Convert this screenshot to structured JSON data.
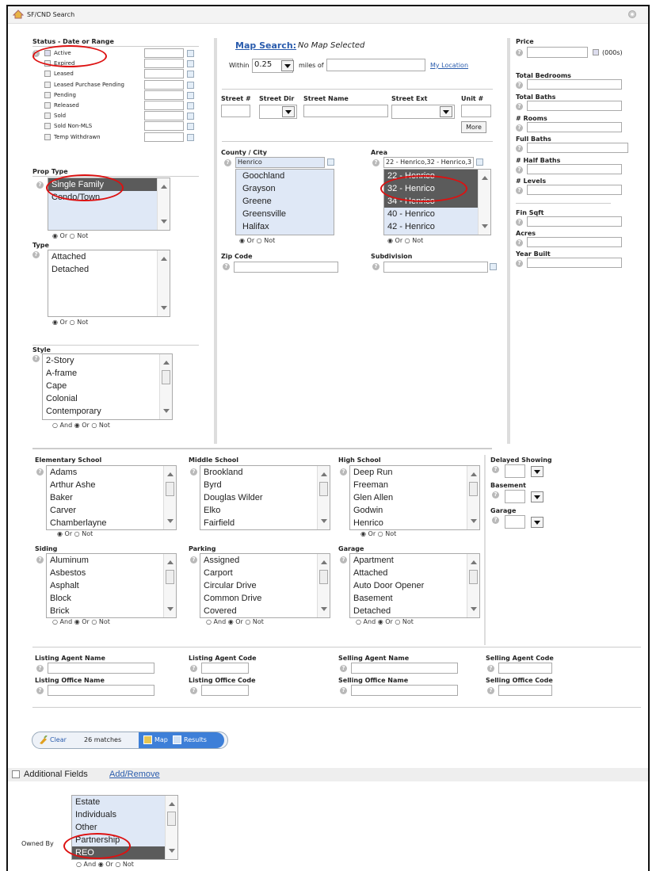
{
  "window": {
    "title": "SF/CND Search"
  },
  "status": {
    "label": "Status - Date or Range",
    "items": [
      {
        "label": "Active",
        "checked": true
      },
      {
        "label": "Expired",
        "checked": false
      },
      {
        "label": "Leased",
        "checked": false
      },
      {
        "label": "Leased Purchase Pending",
        "checked": false
      },
      {
        "label": "Pending",
        "checked": false
      },
      {
        "label": "Released",
        "checked": false
      },
      {
        "label": "Sold",
        "checked": false
      },
      {
        "label": "Sold Non-MLS",
        "checked": false
      },
      {
        "label": "Temp Withdrawn",
        "checked": false
      }
    ]
  },
  "prop_type": {
    "label": "Prop Type",
    "options": [
      "Single Family",
      "Condo/Town"
    ],
    "selected": "Single Family",
    "or_label": "Or",
    "not_label": "Not"
  },
  "type": {
    "label": "Type",
    "options": [
      "Attached",
      "Detached"
    ],
    "or_label": "Or",
    "not_label": "Not"
  },
  "style": {
    "label": "Style",
    "options": [
      "2-Story",
      "A-frame",
      "Cape",
      "Colonial",
      "Contemporary"
    ],
    "and_label": "And",
    "or_label": "Or",
    "not_label": "Not"
  },
  "map": {
    "link": "Map Search:",
    "status": "No Map Selected",
    "within_label": "Within",
    "within_value": "0.25",
    "miles_label": "miles of",
    "my_location": "My Location"
  },
  "street": {
    "num_label": "Street #",
    "dir_label": "Street Dir",
    "name_label": "Street Name",
    "ext_label": "Street Ext",
    "unit_label": "Unit #",
    "more_button": "More"
  },
  "county": {
    "label": "County / City",
    "value": "Henrico",
    "options": [
      "Goochland",
      "Grayson",
      "Greene",
      "Greensville",
      "Halifax"
    ],
    "or_label": "Or",
    "not_label": "Not"
  },
  "area": {
    "label": "Area",
    "value": "22 - Henrico,32 - Henrico,3",
    "options": [
      "22 - Henrico",
      "32 - Henrico",
      "34 - Henrico",
      "40 - Henrico",
      "42 - Henrico"
    ],
    "or_label": "Or",
    "not_label": "Not"
  },
  "zip": {
    "label": "Zip Code"
  },
  "subdivision": {
    "label": "Subdivision"
  },
  "right": {
    "price_label": "Price",
    "price_unit": "(000s)",
    "fields": [
      "Total Bedrooms",
      "Total Baths",
      "# Rooms",
      "Full Baths",
      "# Half Baths",
      "# Levels",
      "Fin Sqft",
      "Acres",
      "Year Built"
    ]
  },
  "elementary": {
    "label": "Elementary School",
    "options": [
      "Adams",
      "Arthur Ashe",
      "Baker",
      "Carver",
      "Chamberlayne"
    ],
    "or_label": "Or",
    "not_label": "Not"
  },
  "middle": {
    "label": "Middle School",
    "options": [
      "Brookland",
      "Byrd",
      "Douglas Wilder",
      "Elko",
      "Fairfield"
    ]
  },
  "high": {
    "label": "High School",
    "options": [
      "Deep Run",
      "Freeman",
      "Glen Allen",
      "Godwin",
      "Henrico"
    ],
    "or_label": "Or",
    "not_label": "Not"
  },
  "delayed": {
    "label": "Delayed Showing"
  },
  "basement": {
    "label": "Basement"
  },
  "garage_dd": {
    "label": "Garage"
  },
  "siding": {
    "label": "Siding",
    "options": [
      "Aluminum",
      "Asbestos",
      "Asphalt",
      "Block",
      "Brick"
    ],
    "and_label": "And",
    "or_label": "Or",
    "not_label": "Not"
  },
  "parking": {
    "label": "Parking",
    "options": [
      "Assigned",
      "Carport",
      "Circular Drive",
      "Common Drive",
      "Covered"
    ],
    "and_label": "And",
    "or_label": "Or",
    "not_label": "Not"
  },
  "garage": {
    "label": "Garage",
    "options": [
      "Apartment",
      "Attached",
      "Auto Door Opener",
      "Basement",
      "Detached"
    ],
    "and_label": "And",
    "or_label": "Or",
    "not_label": "Not"
  },
  "agents": {
    "listing_agent_name": "Listing Agent Name",
    "listing_agent_code": "Listing Agent Code",
    "selling_agent_name": "Selling Agent Name",
    "selling_agent_code": "Selling Agent Code",
    "listing_office_name": "Listing Office Name",
    "listing_office_code": "Listing Office Code",
    "selling_office_name": "Selling Office Name",
    "selling_office_code": "Selling Office Code"
  },
  "toolbar": {
    "clear": "Clear",
    "matches": "26 matches",
    "map": "Map",
    "results": "Results"
  },
  "additional": {
    "title": "Additional Fields",
    "link": "Add/Remove"
  },
  "owned_by": {
    "label": "Owned By",
    "options": [
      "Estate",
      "Individuals",
      "Other",
      "Partnership",
      "REO"
    ],
    "selected": "REO",
    "and_label": "And",
    "or_label": "Or",
    "not_label": "Not"
  }
}
